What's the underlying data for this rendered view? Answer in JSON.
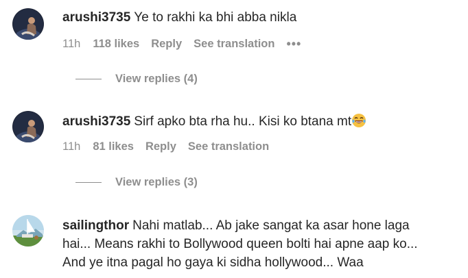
{
  "comments": [
    {
      "username": "arushi3735",
      "text": "Ye to rakhi ka bhi abba nikla",
      "time": "11h",
      "likes": "118 likes",
      "reply": "Reply",
      "translate": "See translation",
      "more": "•••",
      "view_replies": "View replies (4)"
    },
    {
      "username": "arushi3735",
      "text": "Sirf apko bta rha hu.. Kisi ko btana mt",
      "emoji": "laughing-emoji",
      "time": "11h",
      "likes": "81 likes",
      "reply": "Reply",
      "translate": "See translation",
      "view_replies": "View replies (3)"
    },
    {
      "username": "sailingthor",
      "text_line1": "Nahi matlab... Ab jake sangat ka asar hone laga",
      "text_line2": "hai... Means rakhi to Bollywood queen bolti hai apne aap ko...",
      "text_line3": "And ye itna pagal ho gaya ki sidha hollywood... Waa"
    }
  ],
  "colors": {
    "text": "#262626",
    "secondary": "#8e8e8e",
    "background": "#ffffff"
  }
}
